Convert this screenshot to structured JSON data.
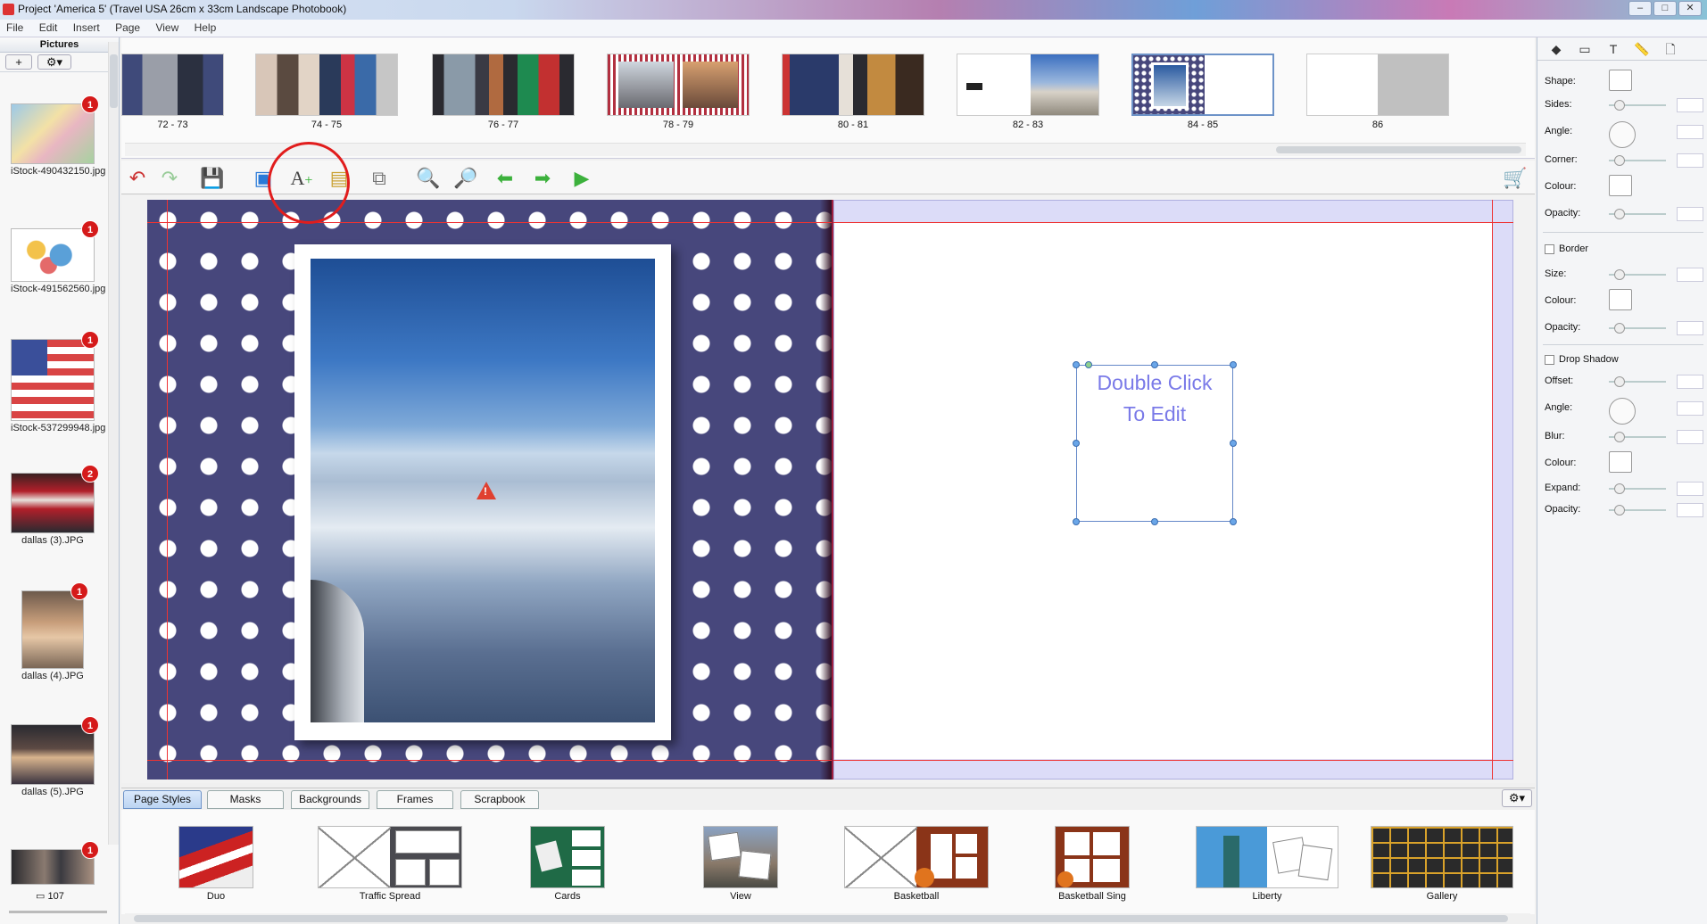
{
  "window": {
    "title": "Project 'America 5' (Travel USA 26cm x 33cm Landscape Photobook)"
  },
  "menu": [
    "File",
    "Edit",
    "Insert",
    "Page",
    "View",
    "Help"
  ],
  "pictures_panel": {
    "header": "Pictures",
    "add_label": "+",
    "gear_label": "⚙▾",
    "items": [
      {
        "name": "iStock-490432150.jpg",
        "badge": "1"
      },
      {
        "name": "iStock-491562560.jpg",
        "badge": "1"
      },
      {
        "name": "iStock-537299948.jpg",
        "badge": "1"
      },
      {
        "name": "dallas (3).JPG",
        "badge": "2"
      },
      {
        "name": "dallas (4).JPG",
        "badge": "1"
      },
      {
        "name": "dallas (5).JPG",
        "badge": "1"
      },
      {
        "name": "",
        "badge": "1"
      }
    ],
    "count": "107"
  },
  "spreads": [
    {
      "label": "72 - 73"
    },
    {
      "label": "74 - 75"
    },
    {
      "label": "76 - 77"
    },
    {
      "label": "78 - 79"
    },
    {
      "label": "80 - 81"
    },
    {
      "label": "82 - 83"
    },
    {
      "label": "84 - 85"
    },
    {
      "label": "86"
    }
  ],
  "textbox": {
    "line1": "Double Click",
    "line2": "To Edit"
  },
  "tabs": [
    "Page Styles",
    "Masks",
    "Backgrounds",
    "Frames",
    "Scrapbook"
  ],
  "page_styles": [
    {
      "label": "Duo"
    },
    {
      "label": "Traffic Spread"
    },
    {
      "label": "Cards"
    },
    {
      "label": "View"
    },
    {
      "label": "Basketball"
    },
    {
      "label": "Basketball Sing"
    },
    {
      "label": "Liberty"
    },
    {
      "label": "Gallery"
    }
  ],
  "properties": {
    "shape": "Shape:",
    "sides": "Sides:",
    "angle": "Angle:",
    "corner": "Corner:",
    "colour": "Colour:",
    "opacity": "Opacity:",
    "border": "Border",
    "size": "Size:",
    "border_colour": "Colour:",
    "border_opacity": "Opacity:",
    "drop_shadow": "Drop Shadow",
    "offset": "Offset:",
    "ds_angle": "Angle:",
    "blur": "Blur:",
    "ds_colour": "Colour:",
    "expand": "Expand:",
    "ds_opacity": "Opacity:"
  },
  "colors": {
    "accent": "#6d93c8",
    "annotation": "#e11d1d",
    "badge": "#d51a1a",
    "page_blue": "#47477c"
  }
}
